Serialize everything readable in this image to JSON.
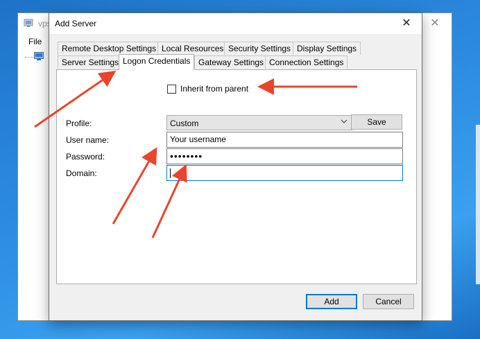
{
  "background_window": {
    "title": "vps",
    "menu_file": "File"
  },
  "dialog": {
    "title": "Add Server",
    "close_glyph": "✕",
    "tabs_row1": [
      "Remote Desktop Settings",
      "Local Resources",
      "Security Settings",
      "Display Settings"
    ],
    "tabs_row2": [
      "Server Settings",
      "Logon Credentials",
      "Gateway Settings",
      "Connection Settings"
    ],
    "active_tab": "Logon Credentials",
    "inherit": {
      "label": "Inherit from parent",
      "checked": false
    },
    "profile": {
      "label": "Profile:",
      "value": "Custom",
      "save_label": "Save"
    },
    "username": {
      "label": "User name:",
      "value": "Your username"
    },
    "password": {
      "label": "Password:",
      "value": "••••••••"
    },
    "domain": {
      "label": "Domain:",
      "value": ""
    },
    "add_label": "Add",
    "cancel_label": "Cancel"
  },
  "colors": {
    "focus": "#0078d7",
    "annotation_arrow": "#e8452c"
  },
  "icons": [
    "app-icon",
    "server-tree-icon",
    "close-icon",
    "chevron-down-icon"
  ]
}
